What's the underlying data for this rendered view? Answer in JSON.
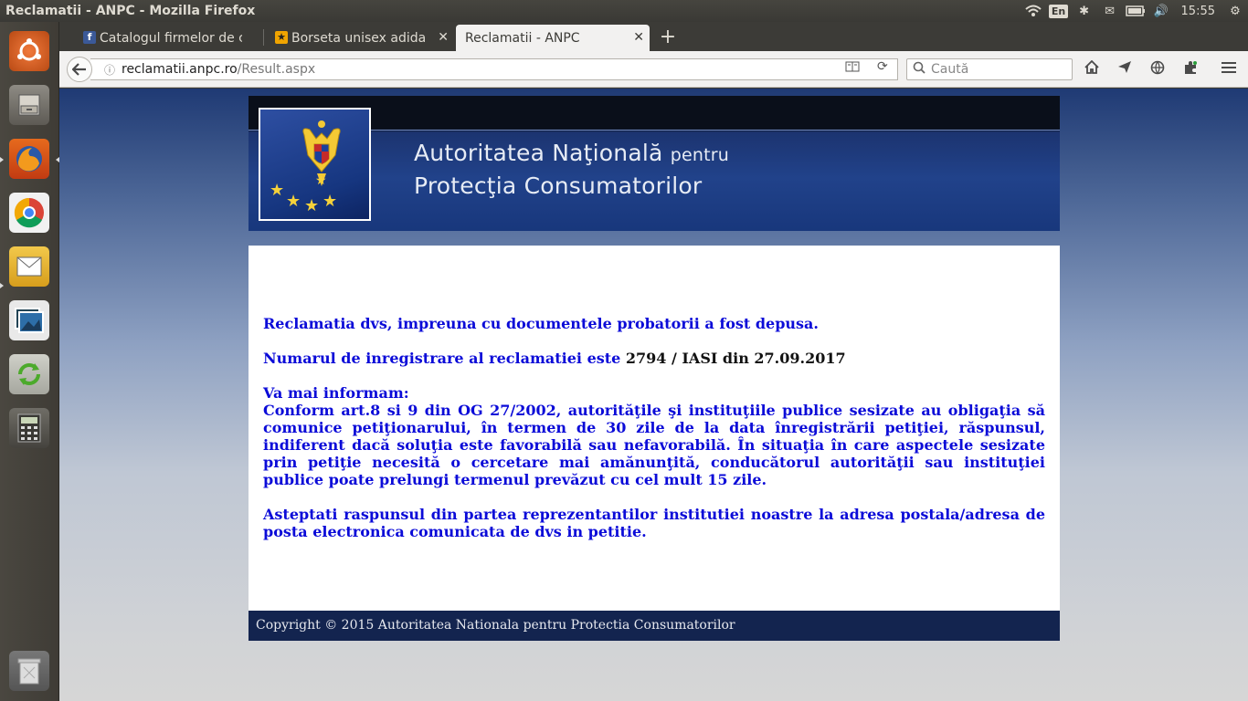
{
  "topbar": {
    "window_title": "Reclamatii - ANPC - Mozilla Firefox",
    "lang": "En",
    "clock": "15:55"
  },
  "launcher": {
    "items": [
      "ubuntu-dash",
      "files",
      "firefox",
      "chrome",
      "mail",
      "photos",
      "update",
      "calculator",
      "trash"
    ]
  },
  "tabs": [
    {
      "label": "Catalogul firmelor de c",
      "favicon": "f"
    },
    {
      "label": "Borseta unisex adidas",
      "favicon": "★"
    },
    {
      "label": "Reclamatii - ANPC",
      "active": true
    }
  ],
  "nav": {
    "url_host": "reclamatii.anpc.ro",
    "url_path": "/Result.aspx",
    "search_placeholder": "Caută"
  },
  "header": {
    "line1": "Autoritatea Naţională",
    "line1_small": "pentru",
    "line2": "Protecţia Consumatorilor"
  },
  "content": {
    "p1": "Reclamatia dvs, impreuna cu documentele probatorii a fost depusa.",
    "p2_label": "Numarul de inregistrare al reclamatiei este",
    "p2_value": "2794 / IASI din 27.09.2017",
    "p3_heading": "Va mai informam:",
    "p3_body": "Conform art.8 si 9 din OG 27/2002, autorităţile şi instituţiile publice sesizate au obligaţia să comunice petiţionarului, în termen de 30 zile de la data înregistrării petiţiei, răspunsul, indiferent dacă soluţia este favorabilă sau nefavorabilă. În situaţia în care aspectele sesizate prin petiţie necesită o cercetare mai amănunţită, conducătorul autorităţii sau instituţiei publice poate prelungi termenul prevăzut cu cel mult 15 zile.",
    "p4": "Asteptati raspunsul din partea reprezentantilor institutiei noastre la adresa postala/adresa de posta electronica comunicata de dvs in petitie."
  },
  "footer": {
    "copyright": "Copyright © 2015 Autoritatea Nationala pentru Protectia Consumatorilor"
  }
}
